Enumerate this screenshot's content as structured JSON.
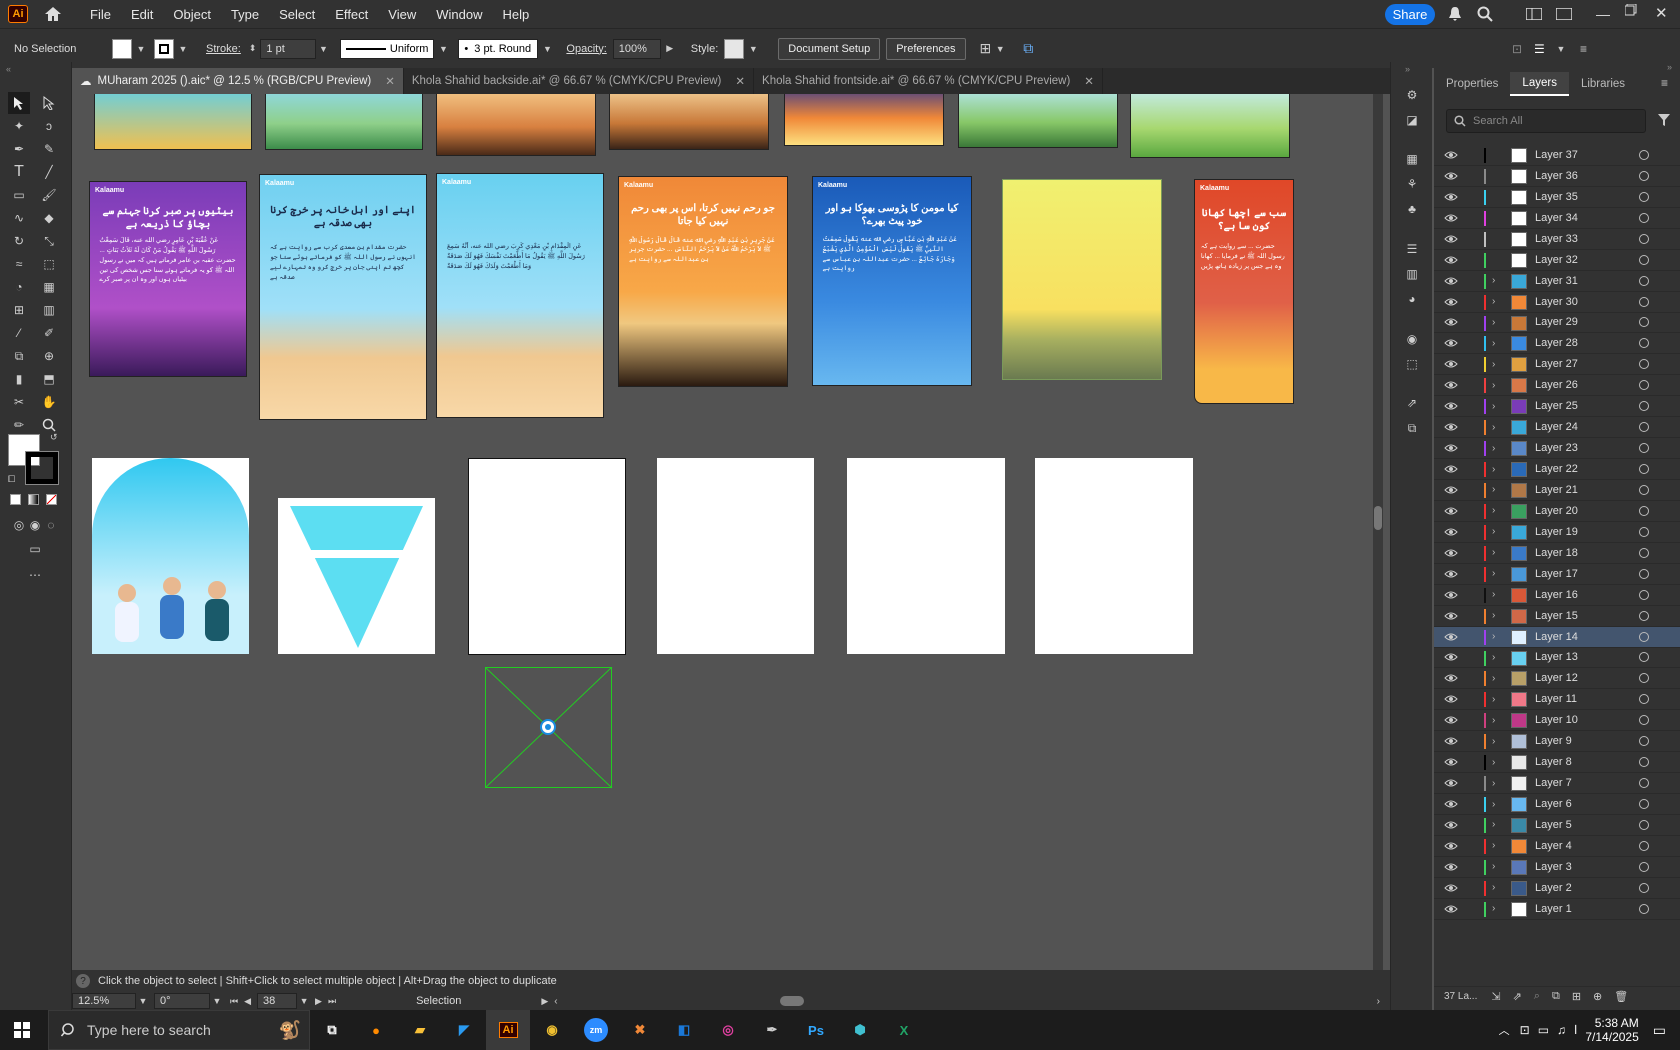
{
  "app": {
    "logo": "Ai",
    "menu": [
      "File",
      "Edit",
      "Object",
      "Type",
      "Select",
      "Effect",
      "View",
      "Window",
      "Help"
    ],
    "share": "Share"
  },
  "control": {
    "selection": "No Selection",
    "stroke_label": "Stroke:",
    "stroke_weight": "1 pt",
    "uniform": "Uniform",
    "brush": "3 pt. Round",
    "opacity_label": "Opacity:",
    "opacity": "100%",
    "style_label": "Style:",
    "doc_setup": "Document Setup",
    "preferences": "Preferences"
  },
  "tabs": [
    {
      "label": "MUharam 2025 ().aic* @ 12.5 % (RGB/CPU Preview)"
    },
    {
      "label": "Khola Shahid backside.ai* @ 66.67 % (CMYK/CPU Preview)"
    },
    {
      "label": "Khola Shahid frontside.ai* @ 66.67 % (CMYK/CPU Preview)"
    }
  ],
  "panel": {
    "tabs": [
      "Properties",
      "Layers",
      "Libraries"
    ],
    "search_placeholder": "Search All",
    "layers": [
      "Layer 37",
      "Layer 36",
      "Layer 35",
      "Layer 34",
      "Layer 33",
      "Layer 32",
      "Layer 31",
      "Layer 30",
      "Layer 29",
      "Layer 28",
      "Layer 27",
      "Layer 26",
      "Layer 25",
      "Layer 24",
      "Layer 23",
      "Layer 22",
      "Layer 21",
      "Layer 20",
      "Layer 19",
      "Layer 18",
      "Layer 17",
      "Layer 16",
      "Layer 15",
      "Layer 14",
      "Layer 13",
      "Layer 12",
      "Layer 11",
      "Layer 10",
      "Layer 9",
      "Layer 8",
      "Layer 7",
      "Layer 6",
      "Layer 5",
      "Layer 4",
      "Layer 3",
      "Layer 2",
      "Layer 1"
    ],
    "selected": "Layer 14",
    "count": "37 La..."
  },
  "cards": [
    {
      "logo": "Kalaamu",
      "title": "بیٹیوں پر صبر کرنا جہنم سے بچاؤ کا ذریعہ ہے",
      "body": "عَنْ عُقْبَةَ بْنِ عَامِرٍ رضي الله عنه، قَالَ سَمِعْتُ رَسُولَ اللَّهِ ﷺ يَقُولُ مَنْ كَانَ لَهُ ثَلاَثُ بَنَاتٍ ... حضرت عقبہ بن عامر فرماتے ہیں کہ میں نے رسول اللہ ﷺ کو یہ فرماتے ہوئے سنا جس شخص کی تین بیٹیاں ہوں اور وہ ان پر صبر کرے"
    },
    {
      "logo": "Kalaamu",
      "title": "اپنے اور اہل خانہ پر خرچ کرنا بھی صدقہ ہے",
      "body": "حضرت مقدام بن معدی کرب سے روایت ہے کہ انہوں نے رسول اللہ ﷺ کو فرماتے ہوئے سنا جو کچھ تم اپنی جان پر خرچ کرو وہ تمہارے لیے صدقہ ہے"
    },
    {
      "logo": "Kalaamu",
      "title": "",
      "body": "عَنِ الْمِقْدَامِ بْنِ مَعْدِي كَرِبَ رضي الله عنه، أَنَّهُ سَمِعَ رَسُولَ اللَّهِ ﷺ يَقُولُ مَا أَطْعَمْتَ نَفْسَكَ فَهُوَ لَكَ صَدَقَةٌ وَمَا أَطْعَمْتَ وَلَدَكَ فَهُوَ لَكَ صَدَقَةٌ"
    },
    {
      "logo": "Kalaamu",
      "title": "جو رحم نہیں کرتا، اس پر بھی رحم نہیں کیا جاتا",
      "body": "عَنْ جَرِيرِ بْنِ عَبْدِ اللَّهِ رضي الله عنه قَالَ قَالَ رَسُولُ اللَّهِ ﷺ لاَ يَرْحَمُ اللَّهُ مَنْ لاَ يَرْحَمُ النَّاسَ ... حضرت جریر بن عبداللہ سے روایت ہے"
    },
    {
      "logo": "Kalaamu",
      "title": "کیا مومن کا پڑوسی بھوکا ہو اور خود پیٹ بھرے؟",
      "body": "عَنْ عَبْدِ اللَّهِ بْنِ عَبَّاسٍ رضي الله عنه يَقُولُ سَمِعْتُ النَّبِيَّ ﷺ يَقُولُ لَيْسَ الْمُؤْمِنُ الَّذِي يَشْبَعُ وَجَارُهُ جَائِعٌ ... حضرت عبداللہ بن عباس سے روایت ہے"
    },
    {
      "logo": "Kalaamu",
      "title": "سب سے اچھا کھانا کون سا ہے؟",
      "body": "حضرت ... سے روایت ہے کہ رسول اللہ ﷺ نے فرمایا ... کھانا وہ ہے جس پر زیادہ ہاتھ پڑیں"
    }
  ],
  "status": {
    "hint": "Click the object to select  |  Shift+Click to select multiple object  |  Alt+Drag the object to duplicate",
    "zoom": "12.5%",
    "rotate": "0°",
    "artboard": "38",
    "mode": "Selection"
  },
  "taskbar": {
    "search": "Type here to search",
    "time": "5:38 AM",
    "date": "7/14/2025"
  }
}
